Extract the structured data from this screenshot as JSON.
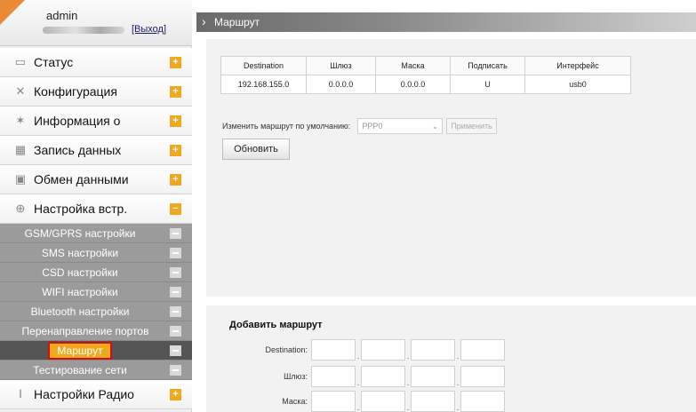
{
  "sidebar": {
    "user": {
      "name": "admin",
      "logout": "[Выход]"
    },
    "menu": [
      {
        "label": "Статус",
        "icon": "monitor-icon"
      },
      {
        "label": "Конфигурация",
        "icon": "tools-icon"
      },
      {
        "label": "Информация о",
        "icon": "info-icon"
      },
      {
        "label": "Запись данных",
        "icon": "calendar-icon"
      },
      {
        "label": "Обмен данными",
        "icon": "network-icon"
      },
      {
        "label": "Настройка встр.",
        "icon": "globe-icon"
      }
    ],
    "submenu": [
      "GSM/GPRS настройки",
      "SMS настройки",
      "CSD настройки",
      "WIFI настройки",
      "Bluetooth настройки",
      "Перенаправление портов",
      "Маршрут",
      "Тестирование сети"
    ],
    "bottom_menu": {
      "label": "Настройки Радио",
      "icon": "antenna-icon"
    }
  },
  "header": {
    "title": "Маршрут"
  },
  "routes_table": {
    "columns": [
      "Destination",
      "Шлюз",
      "Маска",
      "Подписать",
      "Интерфейс"
    ],
    "rows": [
      [
        "192.168.155.0",
        "0.0.0.0",
        "0.0.0.0",
        "U",
        "usb0"
      ]
    ]
  },
  "default_route": {
    "label": "Изменить маршрут по умолчанию:",
    "selected": "PPP0",
    "apply_label": "Применить"
  },
  "refresh_label": "Обновить",
  "add_route": {
    "title": "Добавить маршрут",
    "fields": [
      {
        "label": "Destination:"
      },
      {
        "label": "Шлюз:"
      },
      {
        "label": "Маска:"
      }
    ]
  },
  "colors": {
    "accent": "#f0a81e",
    "active_highlight": "#d01010",
    "submenu_bg": "#9b9b9b"
  }
}
